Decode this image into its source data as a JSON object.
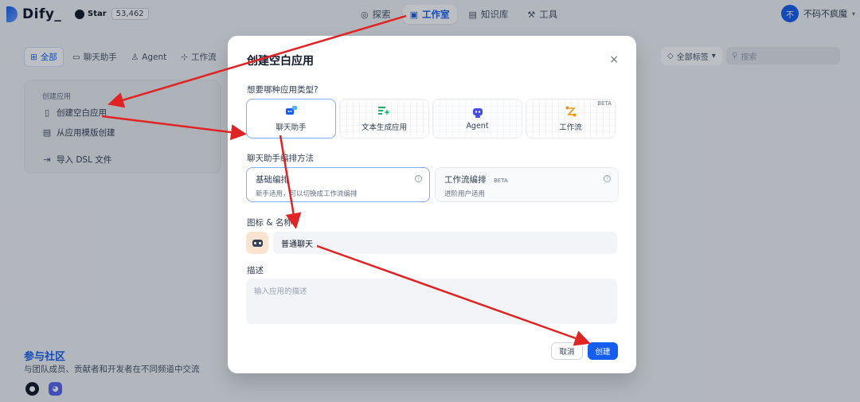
{
  "colors": {
    "accent": "#155eef",
    "annotation_arrow": "#e02424"
  },
  "header": {
    "logo": "Dify_",
    "github": {
      "star_label": "Star",
      "star_count": "53,462"
    },
    "nav": [
      {
        "label": "探索",
        "icon": "compass-icon",
        "active": false
      },
      {
        "label": "工作室",
        "icon": "robot-icon",
        "active": true
      },
      {
        "label": "知识库",
        "icon": "book-icon",
        "active": false
      },
      {
        "label": "工具",
        "icon": "wrench-icon",
        "active": false
      }
    ],
    "user": {
      "avatar_text": "不",
      "name": "不码不疯魔"
    }
  },
  "filters": {
    "tabs": [
      "全部",
      "聊天助手",
      "Agent",
      "工作流"
    ],
    "tag_select": "全部标签",
    "search_placeholder": "搜索"
  },
  "create_card": {
    "title": "创建应用",
    "items": [
      "创建空白应用",
      "从应用模版创建",
      "导入 DSL 文件"
    ]
  },
  "community": {
    "title": "参与社区",
    "desc": "与团队成员、贡献者和开发者在不同频道中交流"
  },
  "modal": {
    "title": "创建空白应用",
    "close": "×",
    "type_question": "想要哪种应用类型?",
    "app_types": [
      {
        "label": "聊天助手",
        "icon": "chat-bot-icon",
        "selected": true,
        "badge": ""
      },
      {
        "label": "文本生成应用",
        "icon": "text-generator-icon",
        "selected": false,
        "badge": ""
      },
      {
        "label": "Agent",
        "icon": "agent-icon",
        "selected": false,
        "badge": ""
      },
      {
        "label": "工作流",
        "icon": "workflow-icon",
        "selected": false,
        "badge": "BETA"
      }
    ],
    "mode_question": "聊天助手编排方法",
    "modes": [
      {
        "title": "基础编排",
        "badge": "",
        "desc": "新手适用，可以切换成工作流编排",
        "selected": true
      },
      {
        "title": "工作流编排",
        "badge": "BETA",
        "desc": "进阶用户适用",
        "selected": false
      }
    ],
    "icon_name_label": "图标 & 名称",
    "name_value": "普通聊天",
    "desc_label": "描述",
    "desc_placeholder": "输入应用的描述",
    "cancel_label": "取消",
    "create_label": "创建"
  }
}
